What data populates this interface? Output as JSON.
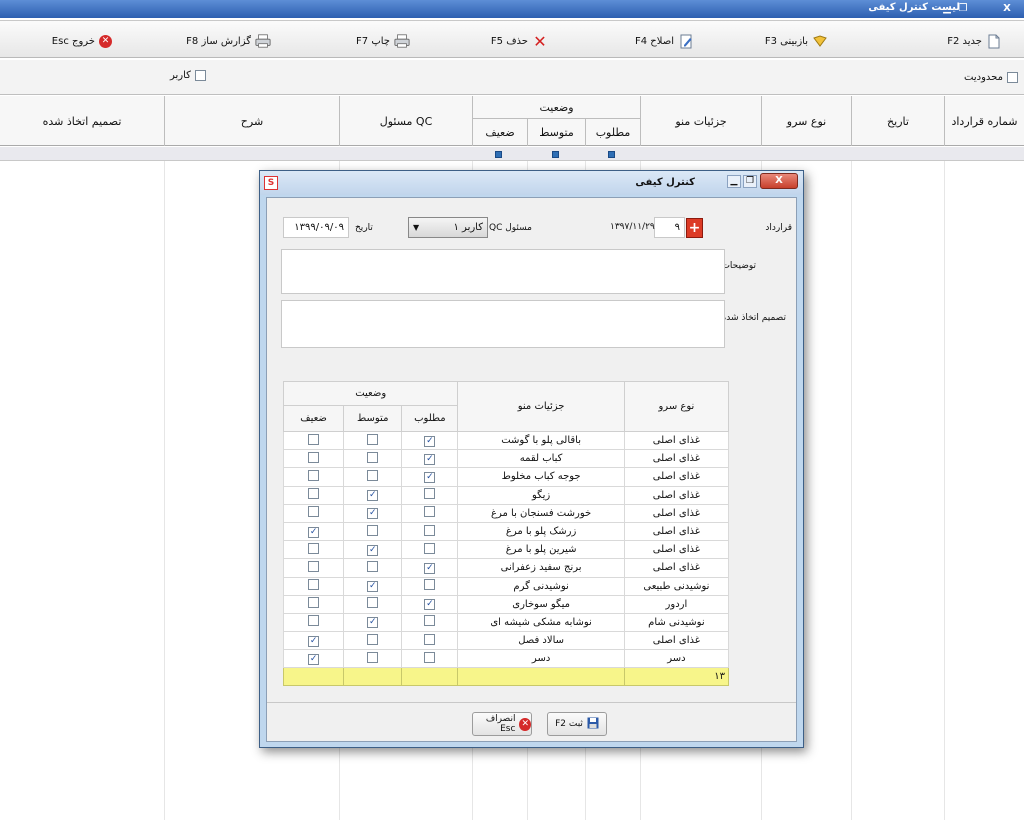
{
  "window": {
    "title": "لیست کنترل کیفی",
    "close_glyph": "X"
  },
  "toolbar": {
    "new": "جدید F2",
    "review": "بازبینی F3",
    "edit": "اصلاح F4",
    "delete": "حذف F5",
    "print": "چاپ F7",
    "report": "گزارش ساز F8",
    "exit": "خروج Esc"
  },
  "filters": {
    "limit_label": "محدودیت",
    "user_label": "کاربر"
  },
  "main_grid": {
    "columns": {
      "contract_no": "شماره قرارداد",
      "date": "تاریخ",
      "service_type": "نوع سرو",
      "menu_details": "جزئیات منو",
      "status": "وضعیت",
      "desired": "مطلوب",
      "medium": "متوسط",
      "weak": "ضعیف",
      "qc_officer": "مسئول QC",
      "description": "شرح",
      "decision": "تصمیم اتخاذ شده"
    }
  },
  "dialog": {
    "title": "کنترل کیفی",
    "contract_label": "قرارداد",
    "contract_value": "۹",
    "contract_date": "۱۳۹۷/۱۱/۲۹",
    "qc_label": "مسئول QC",
    "qc_value": "کاربر ۱",
    "date_label": "تاریخ",
    "date_value": "۱۳۹۹/۰۹/۰۹",
    "notes_label": "توضیحات",
    "decision_label": "تصمیم اتخاذ شده",
    "table_headers": {
      "service_type": "نوع سرو",
      "menu_details": "جزئیات منو",
      "status": "وضعیت",
      "desired": "مطلوب",
      "medium": "متوسط",
      "weak": "ضعیف"
    },
    "rows": [
      {
        "service": "غذای اصلی",
        "menu": "باقالی پلو با گوشت",
        "desired": true,
        "medium": false,
        "weak": false
      },
      {
        "service": "غذای اصلی",
        "menu": "کباب لقمه",
        "desired": true,
        "medium": false,
        "weak": false
      },
      {
        "service": "غذای اصلی",
        "menu": "جوجه کباب مخلوط",
        "desired": true,
        "medium": false,
        "weak": false
      },
      {
        "service": "غذای اصلی",
        "menu": "زیگو",
        "desired": false,
        "medium": true,
        "weak": false
      },
      {
        "service": "غذای اصلی",
        "menu": "خورشت فسنجان با مرغ",
        "desired": false,
        "medium": true,
        "weak": false
      },
      {
        "service": "غذای اصلی",
        "menu": "زرشک پلو با مرغ",
        "desired": false,
        "medium": false,
        "weak": true
      },
      {
        "service": "غذای اصلی",
        "menu": "شیرین پلو با مرغ",
        "desired": false,
        "medium": true,
        "weak": false
      },
      {
        "service": "غذای اصلی",
        "menu": "برنج سفید زعفرانی",
        "desired": true,
        "medium": false,
        "weak": false
      },
      {
        "service": "نوشیدنی طبیعی",
        "menu": "نوشیدنی گرم",
        "desired": false,
        "medium": true,
        "weak": false
      },
      {
        "service": "اردور",
        "menu": "میگو سوخاری",
        "desired": true,
        "medium": false,
        "weak": false
      },
      {
        "service": "نوشیدنی شام",
        "menu": "نوشابه مشکی شیشه ای",
        "desired": false,
        "medium": true,
        "weak": false
      },
      {
        "service": "غذای اصلی",
        "menu": "سالاد فصل",
        "desired": false,
        "medium": false,
        "weak": true
      },
      {
        "service": "دسر",
        "menu": "دسر",
        "desired": false,
        "medium": false,
        "weak": true
      }
    ],
    "total_count": "۱۳",
    "save_label": "ثبت F2",
    "cancel_label": "انصراف Esc"
  }
}
